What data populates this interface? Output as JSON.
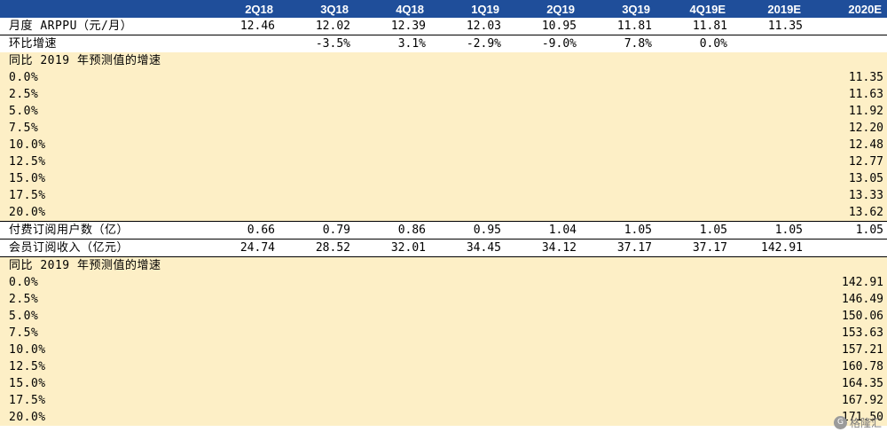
{
  "header": {
    "columns": [
      "",
      "2Q18",
      "3Q18",
      "4Q18",
      "1Q19",
      "2Q19",
      "3Q19",
      "4Q19E",
      "2019E",
      "2020E"
    ]
  },
  "arppu": {
    "label": "月度 ARPPU（元/月）",
    "values": [
      "12.46",
      "12.02",
      "12.39",
      "12.03",
      "10.95",
      "11.81",
      "11.81",
      "11.35",
      ""
    ]
  },
  "qoq": {
    "label": "环比增速",
    "values": [
      "",
      "-3.5%",
      "3.1%",
      "-2.9%",
      "-9.0%",
      "7.8%",
      "0.0%",
      "",
      ""
    ]
  },
  "section1": {
    "label": "同比 2019 年预测值的增速",
    "rows": [
      {
        "label": "0.0%",
        "value": "11.35"
      },
      {
        "label": "2.5%",
        "value": "11.63"
      },
      {
        "label": "5.0%",
        "value": "11.92"
      },
      {
        "label": "7.5%",
        "value": "12.20"
      },
      {
        "label": "10.0%",
        "value": "12.48"
      },
      {
        "label": "12.5%",
        "value": "12.77"
      },
      {
        "label": "15.0%",
        "value": "13.05"
      },
      {
        "label": "17.5%",
        "value": "13.33"
      },
      {
        "label": "20.0%",
        "value": "13.62"
      }
    ]
  },
  "paid_users": {
    "label": "付费订阅用户数（亿）",
    "values": [
      "0.66",
      "0.79",
      "0.86",
      "0.95",
      "1.04",
      "1.05",
      "1.05",
      "1.05",
      "1.05"
    ]
  },
  "revenue": {
    "label": "会员订阅收入（亿元）",
    "values": [
      "24.74",
      "28.52",
      "32.01",
      "34.45",
      "34.12",
      "37.17",
      "37.17",
      "142.91",
      ""
    ]
  },
  "section2": {
    "label": "同比 2019 年预测值的增速",
    "rows": [
      {
        "label": "0.0%",
        "value": "142.91"
      },
      {
        "label": "2.5%",
        "value": "146.49"
      },
      {
        "label": "5.0%",
        "value": "150.06"
      },
      {
        "label": "7.5%",
        "value": "153.63"
      },
      {
        "label": "10.0%",
        "value": "157.21"
      },
      {
        "label": "12.5%",
        "value": "160.78"
      },
      {
        "label": "15.0%",
        "value": "164.35"
      },
      {
        "label": "17.5%",
        "value": "167.92"
      },
      {
        "label": "20.0%",
        "value": "171.50"
      }
    ]
  },
  "watermark": {
    "text": "格隆汇",
    "logo_icon": "gelonghui-logo-icon"
  }
}
